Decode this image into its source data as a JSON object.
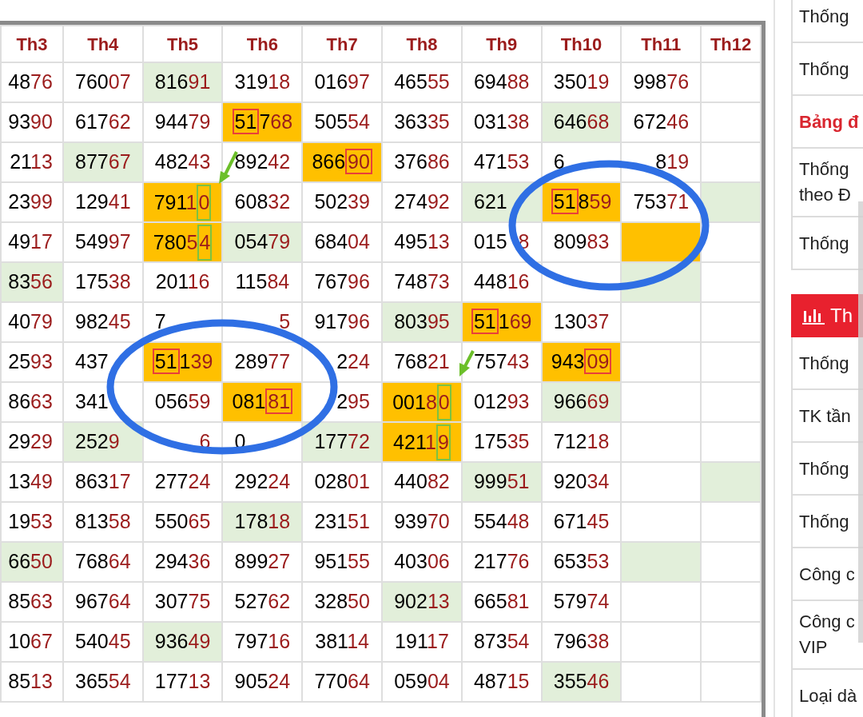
{
  "table": {
    "columns": [
      "Th3",
      "Th4",
      "Th5",
      "Th6",
      "Th7",
      "Th8",
      "Th9",
      "Th10",
      "Th11",
      "Th12"
    ],
    "rows": [
      {
        "cells": [
          {
            "text": "4876"
          },
          {
            "text": "76007"
          },
          {
            "text": "81691",
            "color": "#e2efda"
          },
          {
            "text": "31918"
          },
          {
            "text": "01697"
          },
          {
            "text": "46555"
          },
          {
            "text": "69488"
          },
          {
            "text": "35019"
          },
          {
            "text": "99876"
          },
          {}
        ]
      },
      {
        "cells": [
          {
            "text": "9390"
          },
          {
            "text": "61762"
          },
          {
            "text": "94479"
          },
          {
            "text": "51768",
            "color": "#ffc000",
            "boxed_first_two": true
          },
          {
            "text": "50554"
          },
          {
            "text": "36335"
          },
          {
            "text": "03138"
          },
          {
            "text": "64668",
            "color": "#e2efda"
          },
          {
            "text": "67246"
          },
          {}
        ]
      },
      {
        "cells": [
          {
            "text": "2113"
          },
          {
            "text": "87767",
            "color": "#e2efda"
          },
          {
            "text": "48243"
          },
          {
            "text": "89242"
          },
          {
            "text": "86690",
            "color": "#ffc000",
            "boxed_last_two": true
          },
          {
            "text": "37686"
          },
          {
            "text": "47153"
          },
          {
            "text": "6",
            "covered": true
          },
          {
            "after": "819",
            "covered": true
          },
          {}
        ]
      },
      {
        "cells": [
          {
            "text": "2399"
          },
          {
            "text": "12941"
          },
          {
            "text": "79110",
            "color": "#ffc000",
            "boxed_last_digit": true
          },
          {
            "text": "60832"
          },
          {
            "text": "50239"
          },
          {
            "text": "27492"
          },
          {
            "text": "621",
            "covered": true,
            "color": "#e2efda"
          },
          {
            "text": "51859",
            "color": "#ffc000",
            "boxed_first_two": true
          },
          {
            "text": "75371"
          },
          {
            "color": "#e2efda"
          }
        ]
      },
      {
        "cells": [
          {
            "text": "4917"
          },
          {
            "text": "54997"
          },
          {
            "text": "78054",
            "color": "#ffc000",
            "boxed_last_digit": true
          },
          {
            "text": "05479",
            "color": "#e2efda"
          },
          {
            "text": "68404"
          },
          {
            "text": "49513"
          },
          {
            "text": "015",
            "after": "8",
            "covered": true
          },
          {
            "text": "80983"
          },
          {
            "color": "#ffc000"
          },
          {}
        ]
      },
      {
        "cells": [
          {
            "text": "8356",
            "color": "#e2efda"
          },
          {
            "text": "17538"
          },
          {
            "text": "20116"
          },
          {
            "text": "11584"
          },
          {
            "text": "76796"
          },
          {
            "text": "74873"
          },
          {
            "text": "44816"
          },
          {},
          {
            "color": "#e2efda"
          },
          {}
        ]
      },
      {
        "cells": [
          {
            "text": "4079"
          },
          {
            "text": "98245"
          },
          {
            "text": "7",
            "covered": true
          },
          {
            "after": "5",
            "covered": true
          },
          {
            "text": "91796"
          },
          {
            "text": "80395",
            "color": "#e2efda"
          },
          {
            "text": "51169",
            "color": "#ffc000",
            "boxed_first_two": true
          },
          {
            "text": "13037"
          },
          {},
          {}
        ]
      },
      {
        "cells": [
          {
            "text": "2593"
          },
          {
            "text": "437",
            "covered": true
          },
          {
            "text": "51139",
            "color": "#ffc000",
            "boxed_first_two": true
          },
          {
            "text": "28977"
          },
          {
            "after": "224",
            "covered": true
          },
          {
            "text": "76821"
          },
          {
            "text": "75743"
          },
          {
            "text": "94309",
            "color": "#ffc000",
            "boxed_last_two": true
          },
          {},
          {}
        ]
      },
      {
        "cells": [
          {
            "text": "8663"
          },
          {
            "text": "341",
            "covered": true
          },
          {
            "text": "05659"
          },
          {
            "text": "08181",
            "color": "#ffc000",
            "boxed_last_two": true
          },
          {
            "after": "295",
            "covered": true
          },
          {
            "text": "00180",
            "color": "#ffc000",
            "boxed_last_digit": true
          },
          {
            "text": "01293"
          },
          {
            "text": "96669",
            "color": "#e2efda"
          },
          {},
          {}
        ]
      },
      {
        "cells": [
          {
            "text": "2929"
          },
          {
            "text": "2529",
            "covered": true,
            "color": "#e2efda"
          },
          {
            "after": "6",
            "covered": true
          },
          {
            "text": "0",
            "covered": true
          },
          {
            "text": "17772",
            "color": "#e2efda"
          },
          {
            "text": "42119",
            "color": "#ffc000",
            "boxed_last_digit": true
          },
          {
            "text": "17535"
          },
          {
            "text": "71218"
          },
          {},
          {}
        ]
      },
      {
        "cells": [
          {
            "text": "1349"
          },
          {
            "text": "86317"
          },
          {
            "text": "27724"
          },
          {
            "text": "29224"
          },
          {
            "text": "02801"
          },
          {
            "text": "44082"
          },
          {
            "text": "99951",
            "color": "#e2efda"
          },
          {
            "text": "92034"
          },
          {},
          {
            "color": "#e2efda"
          }
        ]
      },
      {
        "cells": [
          {
            "text": "1953"
          },
          {
            "text": "81358"
          },
          {
            "text": "55065"
          },
          {
            "text": "17818",
            "color": "#e2efda"
          },
          {
            "text": "23151"
          },
          {
            "text": "93970"
          },
          {
            "text": "55448"
          },
          {
            "text": "67145"
          },
          {},
          {}
        ]
      },
      {
        "cells": [
          {
            "text": "6650",
            "color": "#e2efda"
          },
          {
            "text": "76864"
          },
          {
            "text": "29436"
          },
          {
            "text": "89927"
          },
          {
            "text": "95155"
          },
          {
            "text": "40306"
          },
          {
            "text": "21776"
          },
          {
            "text": "65353"
          },
          {
            "color": "#e2efda"
          },
          {}
        ]
      },
      {
        "cells": [
          {
            "text": "8563"
          },
          {
            "text": "96764"
          },
          {
            "text": "30775"
          },
          {
            "text": "52762"
          },
          {
            "text": "32850"
          },
          {
            "text": "90213",
            "color": "#e2efda"
          },
          {
            "text": "66581"
          },
          {
            "text": "57974"
          },
          {},
          {}
        ]
      },
      {
        "cells": [
          {
            "text": "1067"
          },
          {
            "text": "54045"
          },
          {
            "text": "93649",
            "color": "#e2efda"
          },
          {
            "text": "79716"
          },
          {
            "text": "38114"
          },
          {
            "text": "19117"
          },
          {
            "text": "87354"
          },
          {
            "text": "79638"
          },
          {},
          {}
        ]
      },
      {
        "cells": [
          {
            "text": "8513"
          },
          {
            "text": "36554"
          },
          {
            "text": "17713"
          },
          {
            "text": "90524"
          },
          {
            "text": "77064"
          },
          {
            "text": "05904"
          },
          {
            "text": "48715"
          },
          {
            "text": "35546",
            "color": "#e2efda"
          },
          {},
          {}
        ]
      }
    ]
  },
  "sidebar": {
    "groups": [
      {
        "items": [
          {
            "text": "Thống",
            "kind": "link"
          },
          {
            "text": "Thống",
            "kind": "link"
          },
          {
            "text": "Bảng đ",
            "kind": "heading"
          },
          {
            "text": "Thống\ntheo Đ",
            "kind": "link"
          },
          {
            "text": "Thống",
            "kind": "link"
          }
        ]
      },
      {
        "title": "Th",
        "items": [
          {
            "text": "Thống",
            "kind": "link"
          },
          {
            "text": "TK tần",
            "kind": "link"
          },
          {
            "text": "Thống",
            "kind": "link"
          },
          {
            "text": "Thống",
            "kind": "link"
          },
          {
            "text": "Công c",
            "kind": "link"
          },
          {
            "text": "Công c\nVIP",
            "kind": "link"
          },
          {
            "text": "Loại dà",
            "kind": "link"
          }
        ]
      }
    ]
  }
}
